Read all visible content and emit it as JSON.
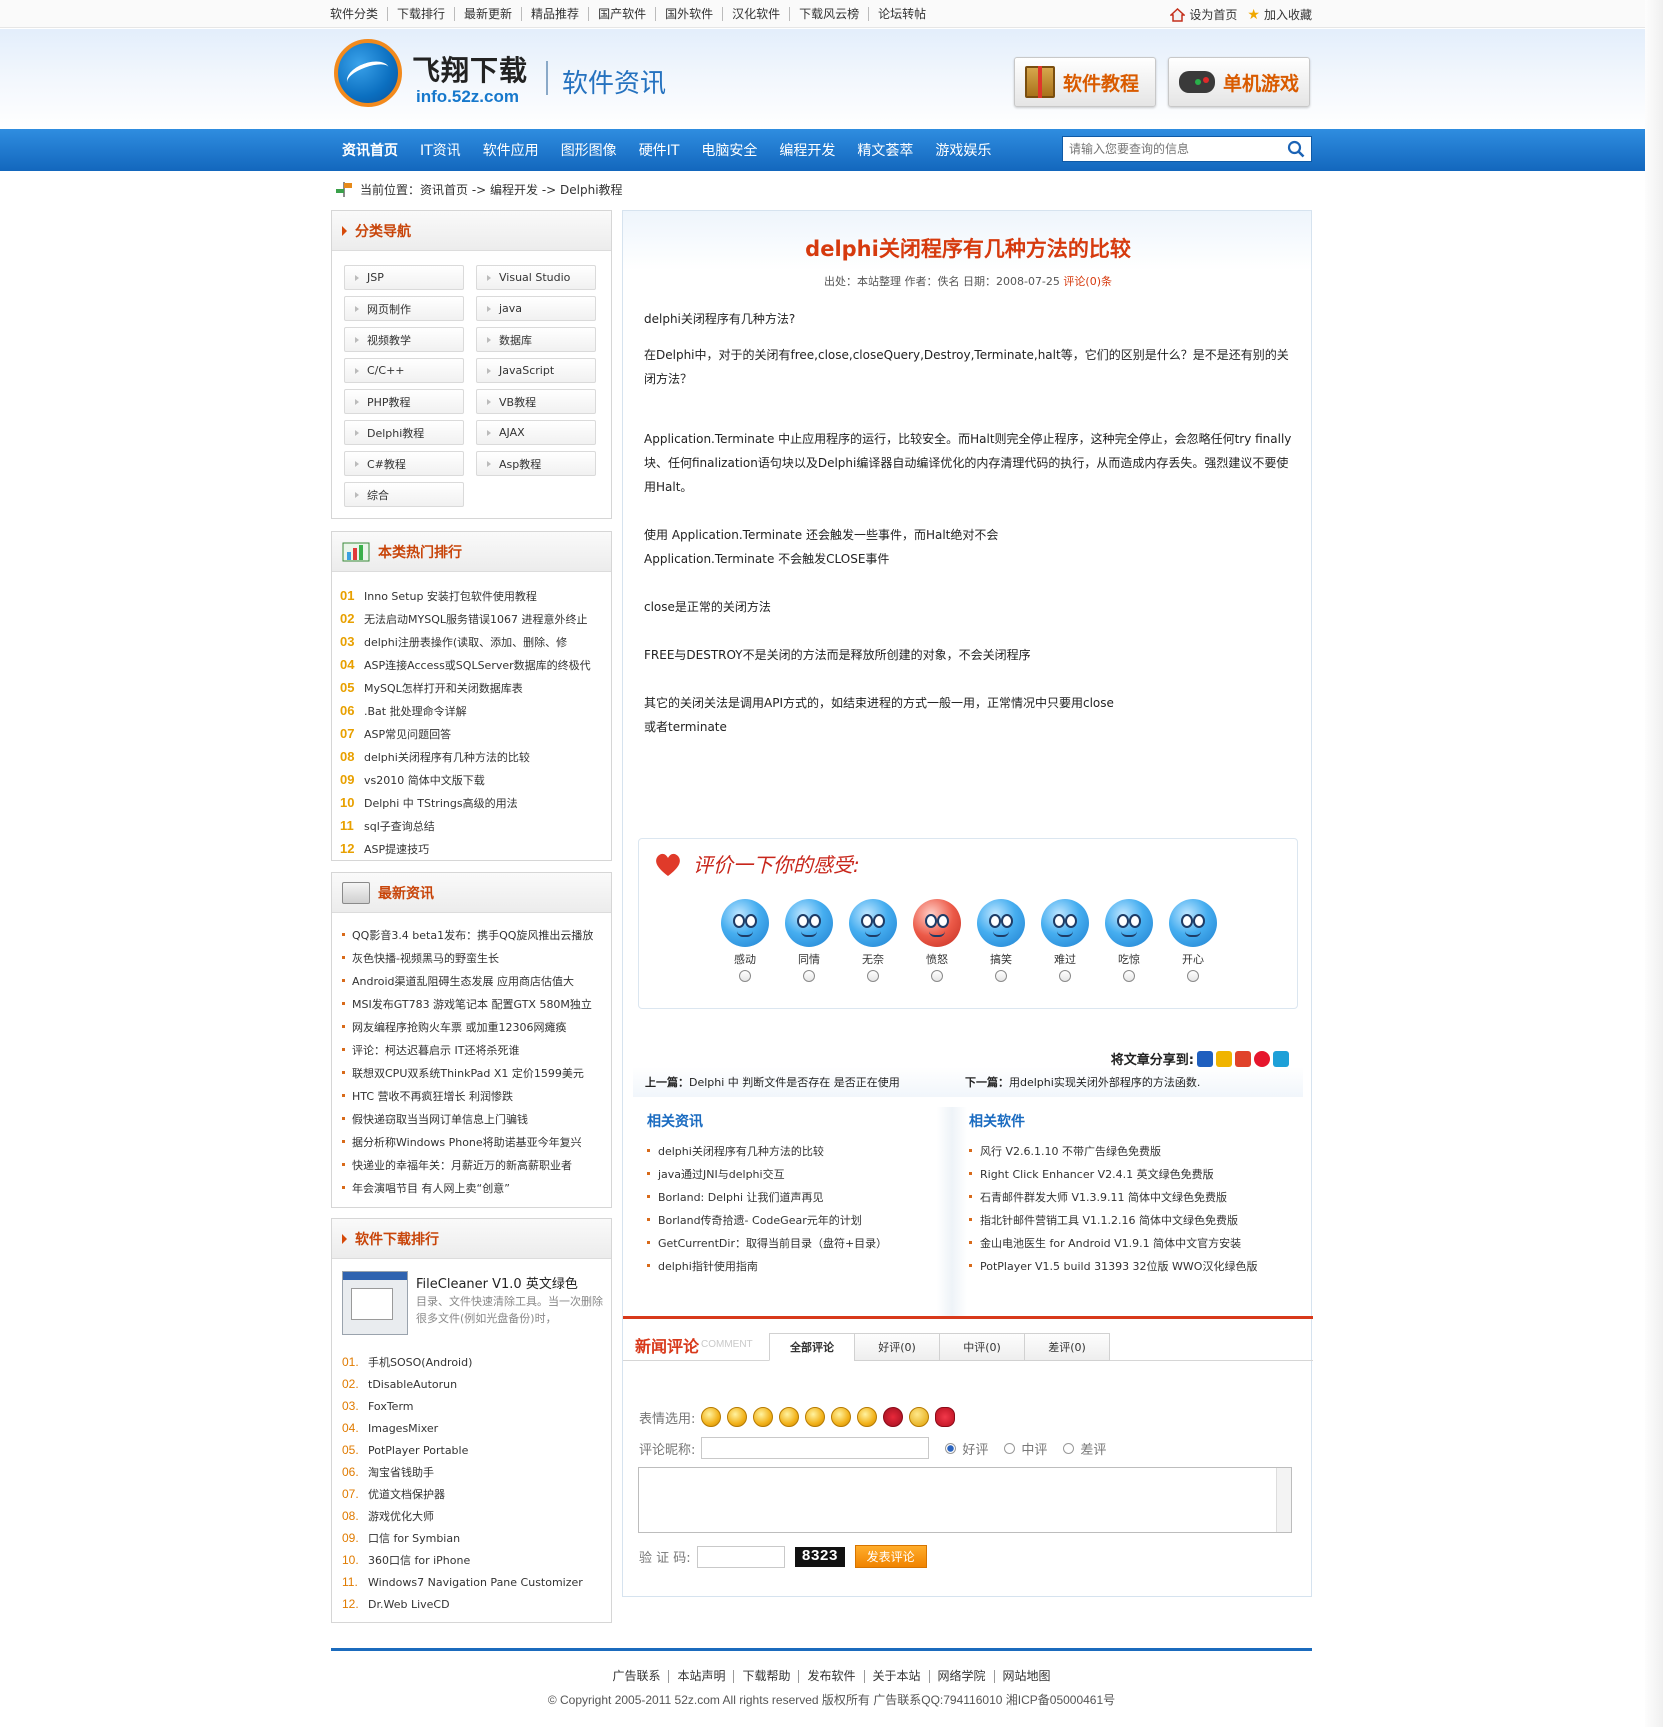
{
  "topbar": {
    "links": [
      "软件分类",
      "下载排行",
      "最新更新",
      "精品推荐",
      "国产软件",
      "国外软件",
      "汉化软件",
      "下载风云榜",
      "论坛转帖"
    ],
    "set_home": "设为首页",
    "add_fav": "加入收藏"
  },
  "header": {
    "logo_cn": "飞翔下载",
    "logo_url": "info.52z.com",
    "section_title": "软件资讯",
    "btn_tutorial": "软件教程",
    "btn_game": "单机游戏"
  },
  "nav": {
    "items": [
      "资讯首页",
      "IT资讯",
      "软件应用",
      "图形图像",
      "硬件IT",
      "电脑安全",
      "编程开发",
      "精文荟萃",
      "游戏娱乐"
    ],
    "search_placeholder": "请输入您要查询的信息"
  },
  "breadcrumb": {
    "text": "当前位置：资讯首页 -> 编程开发 -> Delphi教程"
  },
  "sidebar": {
    "category_title": "分类导航",
    "categories": [
      "JSP",
      "Visual Studio",
      "网页制作",
      "java",
      "视频教学",
      "数据库",
      "C/C++",
      "JavaScript",
      "PHP教程",
      "VB教程",
      "Delphi教程",
      "AJAX",
      "C#教程",
      "Asp教程",
      "综合"
    ],
    "hot_title": "本类热门排行",
    "hot": [
      {
        "n": "01",
        "t": "Inno Setup 安装打包软件使用教程"
      },
      {
        "n": "02",
        "t": "无法启动MYSQL服务错误1067 进程意外终止"
      },
      {
        "n": "03",
        "t": "delphi注册表操作(读取、添加、删除、修"
      },
      {
        "n": "04",
        "t": "ASP连接Access或SQLServer数据库的终极代"
      },
      {
        "n": "05",
        "t": "MySQL怎样打开和关闭数据库表"
      },
      {
        "n": "06",
        "t": ".Bat 批处理命令详解"
      },
      {
        "n": "07",
        "t": "ASP常见问题回答"
      },
      {
        "n": "08",
        "t": "delphi关闭程序有几种方法的比较"
      },
      {
        "n": "09",
        "t": "vs2010 简体中文版下载"
      },
      {
        "n": "10",
        "t": "Delphi 中 TStrings高级的用法"
      },
      {
        "n": "11",
        "t": "sql子查询总结"
      },
      {
        "n": "12",
        "t": "ASP提速技巧"
      }
    ],
    "news_title": "最新资讯",
    "news": [
      "QQ影音3.4 beta1发布：携手QQ旋风推出云播放",
      "灰色快播-视频黑马的野蛮生长",
      "Android渠道乱阻碍生态发展 应用商店估值大",
      "MSI发布GT783 游戏笔记本 配置GTX 580M独立",
      "网友编程序抢购火车票 或加重12306网瘫痪",
      "评论：柯达迟暮启示 IT还将杀死谁",
      "联想双CPU双系统ThinkPad X1 定价1599美元",
      "HTC 营收不再疯狂增长 利润惨跌",
      "假快递窃取当当网订单信息上门骗钱",
      "据分析称Windows Phone将助诺基亚今年复兴",
      "快递业的幸福年关：月薪近万的新高薪职业者",
      "年会演唱节目 有人网上卖“创意”"
    ],
    "dl_title": "软件下载排行",
    "dl_feature_title": "FileCleaner V1.0 英文绿色",
    "dl_feature_desc": "目录、文件快速清除工具。当一次删除很多文件(例如光盘备份)时，",
    "dl": [
      {
        "n": "01.",
        "t": "手机SOSO(Android)"
      },
      {
        "n": "02.",
        "t": "tDisableAutorun"
      },
      {
        "n": "03.",
        "t": "FoxTerm"
      },
      {
        "n": "04.",
        "t": "ImagesMixer"
      },
      {
        "n": "05.",
        "t": "PotPlayer Portable"
      },
      {
        "n": "06.",
        "t": "淘宝省钱助手"
      },
      {
        "n": "07.",
        "t": "优道文档保护器"
      },
      {
        "n": "08.",
        "t": "游戏优化大师"
      },
      {
        "n": "09.",
        "t": "口信 for Symbian"
      },
      {
        "n": "10.",
        "t": "360口信 for iPhone"
      },
      {
        "n": "11.",
        "t": "Windows7 Navigation Pane Customizer"
      },
      {
        "n": "12.",
        "t": "Dr.Web LiveCD"
      }
    ]
  },
  "article": {
    "title": "delphi关闭程序有几种方法的比较",
    "meta_prefix": "出处：本站整理  作者：佚名  日期：2008-07-25",
    "meta_comments": "评论(0)条",
    "paragraphs": [
      "delphi关闭程序有几种方法?",
      "在Delphi中，对于的关闭有free,close,closeQuery,Destroy,Terminate,halt等，它们的区别是什么？是不是还有别的关闭方法？",
      "Application.Terminate 中止应用程序的运行，比较安全。而Halt则完全停止程序，这种完全停止，会忽略任何try finally块、任何finalization语句块以及Delphi编译器自动编译优化的内存清理代码的执行，从而造成内存丢失。强烈建议不要使用Halt。",
      "使用 Application.Terminate 还会触发一些事件，而Halt绝对不会",
      "Application.Terminate 不会触发CLOSE事件",
      "close是正常的关闭方法",
      "FREE与DESTROY不是关闭的方法而是释放所创建的对象，不会关闭程序",
      "其它的关闭关法是调用API方式的，如结束进程的方式一般一用，正常情况中只要用close",
      "或者terminate"
    ],
    "mood_title": "评价一下你的感受:",
    "moods": [
      "感动",
      "同情",
      "无奈",
      "愤怒",
      "搞笑",
      "难过",
      "吃惊",
      "开心"
    ],
    "share_label": "将文章分享到:",
    "prev_label": "上一篇：",
    "prev_text": "Delphi 中 判断文件是否存在 是否正在使用",
    "next_label": "下一篇：",
    "next_text": "用delphi实现关闭外部程序的方法函数."
  },
  "related": {
    "news_title": "相关资讯",
    "news": [
      "delphi关闭程序有几种方法的比较",
      "java通过JNI与delphi交互",
      "Borland: Delphi 让我们道声再见",
      "Borland传奇拾遗- CodeGear元年的计划",
      "GetCurrentDir：取得当前目录（盘符+目录）",
      "delphi指针使用指南"
    ],
    "soft_title": "相关软件",
    "soft": [
      "风行 V2.6.1.10 不带广告绿色免费版",
      "Right Click Enhancer V2.4.1 英文绿色免费版",
      "石青邮件群发大师 V1.3.9.11 简体中文绿色免费版",
      "指北针邮件营销工具 V1.1.2.16 简体中文绿色免费版",
      "金山电池医生 for Android V1.9.1 简体中文官方安装",
      "PotPlayer V1.5 build 31393 32位版 WWO汉化绿色版"
    ]
  },
  "comment": {
    "title": "新闻评论",
    "title_en": "COMMENT",
    "tabs": [
      "全部评论",
      "好评(0)",
      "中评(0)",
      "差评(0)"
    ],
    "emoji_label": "表情选用:",
    "nick_label": "评论昵称:",
    "rating_options": [
      "好评",
      "中评",
      "差评"
    ],
    "code_label": "验 证 码:",
    "captcha": "8323",
    "submit": "发表评论"
  },
  "footer": {
    "links": [
      "广告联系",
      "本站声明",
      "下载帮助",
      "发布软件",
      "关于本站",
      "网络学院",
      "网站地图"
    ],
    "copyright": "© Copyright 2005-2011 52z.com All rights reserved  版权所有  广告联系QQ:794116010  湘ICP备05000461号"
  }
}
